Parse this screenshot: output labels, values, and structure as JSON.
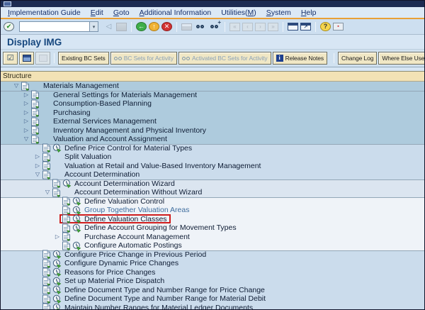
{
  "page": {
    "title": "Display IMG"
  },
  "menu": {
    "items": [
      {
        "label": "Implementation Guide",
        "accel": 0
      },
      {
        "label": "Edit",
        "accel": 0
      },
      {
        "label": "Goto",
        "accel": 0
      },
      {
        "label": "Additional Information",
        "accel": 0
      },
      {
        "label": "Utilities(M)",
        "accel": 10
      },
      {
        "label": "System",
        "accel": 0
      },
      {
        "label": "Help",
        "accel": 0
      }
    ]
  },
  "system_toolbar": {
    "command_field": {
      "value": "",
      "placeholder": ""
    },
    "items": [
      {
        "kind": "icon",
        "name": "enter-icon",
        "style": "circle-enter",
        "glyph": "✔",
        "enabled": true
      },
      {
        "kind": "input",
        "name": "command-field"
      },
      {
        "kind": "icon",
        "name": "collapse-toolbar-icon",
        "style": "tri",
        "glyph": "◁",
        "enabled": true
      },
      {
        "kind": "icon",
        "name": "save-icon",
        "style": "floppy",
        "enabled": false
      },
      {
        "kind": "sep"
      },
      {
        "kind": "icon",
        "name": "back-icon",
        "style": "circle-green",
        "glyph": "←",
        "enabled": true
      },
      {
        "kind": "icon",
        "name": "exit-icon",
        "style": "circle-yellow",
        "glyph": "↑",
        "enabled": true
      },
      {
        "kind": "icon",
        "name": "cancel-icon",
        "style": "circle-red",
        "glyph": "✕",
        "enabled": true
      },
      {
        "kind": "sep"
      },
      {
        "kind": "icon",
        "name": "print-icon",
        "style": "printer",
        "enabled": false
      },
      {
        "kind": "icon",
        "name": "find-icon",
        "style": "binoculars",
        "enabled": true
      },
      {
        "kind": "icon",
        "name": "find-next-icon",
        "style": "binoculars",
        "badge": "+",
        "enabled": true
      },
      {
        "kind": "sep"
      },
      {
        "kind": "icon",
        "name": "first-page-icon",
        "style": "page",
        "glyph": "«",
        "enabled": false
      },
      {
        "kind": "icon",
        "name": "prev-page-icon",
        "style": "page",
        "glyph": "‹",
        "enabled": false
      },
      {
        "kind": "icon",
        "name": "next-page-icon",
        "style": "page",
        "glyph": "›",
        "enabled": false
      },
      {
        "kind": "icon",
        "name": "last-page-icon",
        "style": "page",
        "glyph": "»",
        "enabled": false
      },
      {
        "kind": "sep"
      },
      {
        "kind": "icon",
        "name": "new-session-icon",
        "style": "window",
        "enabled": true
      },
      {
        "kind": "icon",
        "name": "create-shortcut-icon",
        "style": "window-arrow",
        "glyph": "↗",
        "enabled": true
      },
      {
        "kind": "sep"
      },
      {
        "kind": "icon",
        "name": "help-icon",
        "style": "circle-help",
        "glyph": "?",
        "enabled": true
      },
      {
        "kind": "icon",
        "name": "layout-menu-icon",
        "style": "monitor",
        "glyph": "▪",
        "enabled": true
      }
    ]
  },
  "app_toolbar": {
    "icon_buttons": [
      {
        "name": "choose-icon-button",
        "icon": "check-box",
        "enabled": true
      },
      {
        "name": "bc-set-display-icon-button",
        "icon": "blue-window",
        "enabled": true
      },
      {
        "name": "copy-icon-button",
        "icon": "gray-window",
        "enabled": false
      }
    ],
    "buttons": [
      {
        "label": "Existing BC Sets",
        "enabled": true
      },
      {
        "label": "BC Sets for Activity",
        "enabled": false,
        "icon": "glasses"
      },
      {
        "label": "Activated BC Sets for Activity",
        "enabled": false,
        "icon": "glasses"
      },
      {
        "label": "Release Notes",
        "enabled": true,
        "icon": "info"
      }
    ],
    "right_buttons": [
      {
        "label": "Change Log",
        "enabled": true
      },
      {
        "label": "Where Else Used",
        "enabled": true
      }
    ]
  },
  "tree": {
    "header": "Structure",
    "rows": [
      {
        "label": "Materials Management",
        "level": 1,
        "type": "folder",
        "expanded": true,
        "band": 1
      },
      {
        "label": "General Settings for Materials Management",
        "level": 2,
        "type": "folder",
        "expanded": false,
        "band": 1,
        "sep": true
      },
      {
        "label": "Consumption-Based Planning",
        "level": 2,
        "type": "folder",
        "expanded": false,
        "band": 1
      },
      {
        "label": "Purchasing",
        "level": 2,
        "type": "folder",
        "expanded": false,
        "band": 1
      },
      {
        "label": "External Services Management",
        "level": 2,
        "type": "folder",
        "expanded": false,
        "band": 1
      },
      {
        "label": "Inventory Management and Physical Inventory",
        "level": 2,
        "type": "folder",
        "expanded": false,
        "band": 1
      },
      {
        "label": "Valuation and Account Assignment",
        "level": 2,
        "type": "folder",
        "expanded": true,
        "band": 1
      },
      {
        "label": "Define Price Control for Material Types",
        "level": 3,
        "type": "activity",
        "band": 2,
        "sep": true
      },
      {
        "label": "Split Valuation",
        "level": 3,
        "type": "folder",
        "expanded": false,
        "band": 2
      },
      {
        "label": "Valuation at Retail and Value-Based Inventory Management",
        "level": 3,
        "type": "folder",
        "expanded": false,
        "band": 2
      },
      {
        "label": "Account Determination",
        "level": 3,
        "type": "folder",
        "expanded": true,
        "band": 2
      },
      {
        "label": "Account Determination Wizard",
        "level": 4,
        "type": "activity",
        "band": 3,
        "sep": true
      },
      {
        "label": "Account Determination Without Wizard",
        "level": 4,
        "type": "folder",
        "expanded": true,
        "band": 3
      },
      {
        "label": "Define Valuation Control",
        "level": 5,
        "type": "activity",
        "band": 4,
        "sep": true
      },
      {
        "label": "Group Together Valuation Areas",
        "level": 5,
        "type": "activity",
        "band": 4,
        "link": true
      },
      {
        "label": "Define Valuation Classes",
        "level": 5,
        "type": "activity",
        "band": 4,
        "highlight": true
      },
      {
        "label": "Define Account Grouping for Movement Types",
        "level": 5,
        "type": "activity",
        "band": 4
      },
      {
        "label": "Purchase Account Management",
        "level": 5,
        "type": "folder",
        "expanded": false,
        "band": 4
      },
      {
        "label": "Configure Automatic Postings",
        "level": 5,
        "type": "activity",
        "band": 4
      },
      {
        "label": "Configure Price Change in Previous Period",
        "level": 3,
        "type": "activity",
        "band": 2,
        "sep": true
      },
      {
        "label": "Configure Dynamic Price Changes",
        "level": 3,
        "type": "activity",
        "band": 2
      },
      {
        "label": "Reasons for Price Changes",
        "level": 3,
        "type": "activity",
        "band": 2
      },
      {
        "label": "Set up Material Price Dispatch",
        "level": 3,
        "type": "activity",
        "band": 2
      },
      {
        "label": "Define Document Type and Number Range for Price Change",
        "level": 3,
        "type": "activity",
        "band": 2
      },
      {
        "label": "Define Document Type and Number Range for Material Debit",
        "level": 3,
        "type": "activity",
        "band": 2
      },
      {
        "label": "Maintain Number Ranges for Material Ledger Documents",
        "level": 3,
        "type": "activity",
        "band": 2
      }
    ]
  },
  "colors": {
    "orange_rule": "#e89b2e",
    "tree_band1": "#aecbdd",
    "tree_band2": "#cbdcec",
    "tree_band3": "#dbe5f0",
    "tree_band4": "#eff3f8",
    "highlight_box_red": "#cf1d1d",
    "link_text_blue": "#3f6d9e",
    "structure_header_bg": "#f2e2b5",
    "button_bg": "#f0e7c5",
    "title_text": "#16477e"
  }
}
